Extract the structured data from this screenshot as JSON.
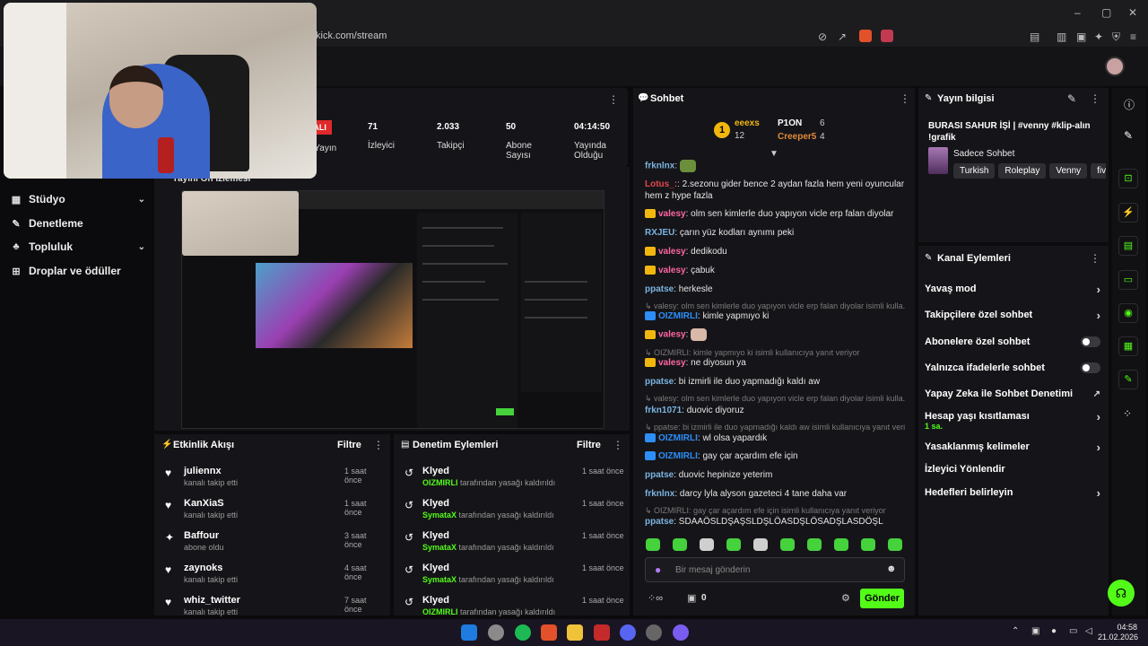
{
  "browser": {
    "url": "kick.com/stream",
    "window_controls": [
      "minimize",
      "maximize",
      "close"
    ]
  },
  "nav": {
    "items": [
      {
        "label": "Stüdyo",
        "icon": "studio-icon",
        "expandable": true
      },
      {
        "label": "Denetleme",
        "icon": "wrench-icon",
        "expandable": false
      },
      {
        "label": "Topluluk",
        "icon": "community-icon",
        "expandable": true
      },
      {
        "label": "Droplar ve ödüller",
        "icon": "drops-icon",
        "expandable": false
      }
    ]
  },
  "stats": {
    "live_label": "PALI",
    "live_caption": "lu Yayın",
    "viewers": {
      "value": "71",
      "label": "İzleyici"
    },
    "followers": {
      "value": "2.033",
      "label": "Takipçi"
    },
    "subs": {
      "value": "50",
      "label": "Abone Sayısı"
    },
    "uptime": {
      "value": "04:14:50",
      "label": "Yayında Olduğu"
    }
  },
  "preview": {
    "title": "Yayını Ön İzlemesi"
  },
  "activity": {
    "title": "Etkinlik Akışı",
    "filter": "Filtre",
    "items": [
      {
        "name": "juliennx",
        "sub": "kanalı takip etti",
        "time": "1 saat önce",
        "icon": "heart-icon"
      },
      {
        "name": "KanXiaS",
        "sub": "kanalı takip etti",
        "time": "1 saat önce",
        "icon": "heart-icon"
      },
      {
        "name": "Baffour",
        "sub": "abone oldu",
        "time": "3 saat önce",
        "icon": "star-icon"
      },
      {
        "name": "zaynoks",
        "sub": "kanalı takip etti",
        "time": "4 saat önce",
        "icon": "heart-icon"
      },
      {
        "name": "whiz_twitter",
        "sub": "kanalı takip etti",
        "time": "7 saat önce",
        "icon": "heart-icon"
      }
    ]
  },
  "modlog": {
    "title": "Denetim Eylemleri",
    "filter": "Filtre",
    "items": [
      {
        "name": "Klyed",
        "target": "OIZMIRLI",
        "action": "tarafından yasağı kaldırıldı",
        "time": "1 saat önce"
      },
      {
        "name": "Klyed",
        "target": "SymataX",
        "action": "tarafından yasağı kaldırıldı",
        "time": "1 saat önce"
      },
      {
        "name": "Klyed",
        "target": "SymataX",
        "action": "tarafından yasağı kaldırıldı",
        "time": "1 saat önce"
      },
      {
        "name": "Klyed",
        "target": "SymataX",
        "action": "tarafından yasağı kaldırıldı",
        "time": "1 saat önce"
      },
      {
        "name": "Klyed",
        "target": "OIZMIRLI",
        "action": "tarafından yasağı kaldırıldı",
        "time": "1 saat önce"
      }
    ]
  },
  "chat": {
    "title": "Sohbet",
    "leaderboard": {
      "rank": "1",
      "first": {
        "name": "eeexs",
        "count": "12"
      },
      "second": {
        "name": "P1ON",
        "count": "6"
      },
      "third": {
        "name": "Creeper5",
        "count": "4"
      }
    },
    "messages": [
      {
        "user": "frknlnx",
        "color": "#7bb3e0",
        "text": "",
        "emote": true
      },
      {
        "user": "Lotus_:",
        "color": "#e2474b",
        "text": "2.sezonu gider bence 2 aydan fazla hem yeni oyuncular hem z hype fazla"
      },
      {
        "user": "valesy",
        "color": "#ff66a3",
        "text": "olm sen kimlerle duo yapıyon vicle erp falan diyolar"
      },
      {
        "user": "RXJEU",
        "color": "#7bb3e0",
        "text": "çarın yüz kodları aynımı peki"
      },
      {
        "user": "valesy",
        "color": "#ff66a3",
        "text": "dedikodu"
      },
      {
        "user": "valesy",
        "color": "#ff66a3",
        "text": "çabuk"
      },
      {
        "user": "ppatse",
        "color": "#7bb3e0",
        "text": "herkesle"
      },
      {
        "reply": "valesy: olm sen kimlerle duo yapıyon vicle erp falan diyolar isimli kulla..."
      },
      {
        "user": "OIZMIRLI",
        "color": "#2d8ef7",
        "text": "kimle yapmıyo ki"
      },
      {
        "user": "valesy",
        "color": "#ff66a3",
        "text": "",
        "emote": true
      },
      {
        "reply": "OIZMIRLI: kimle yapmıyo ki isimli kullanıcıya yanıt veriyor"
      },
      {
        "user": "valesy",
        "color": "#ff66a3",
        "text": "ne diyosun ya"
      },
      {
        "user": "ppatse",
        "color": "#7bb3e0",
        "text": "bi izmirli ile duo yapmadığı kaldı aw"
      },
      {
        "reply": "valesy: olm sen kimlerle duo yapıyon vicle erp falan diyolar isimli kulla..."
      },
      {
        "user": "frkn1071",
        "color": "#7bb3e0",
        "text": "duovic diyoruz"
      },
      {
        "reply": "ppatse: bi izmirli ile duo yapmadığı kaldı aw isimli kullanıcıya yanıt veriyor"
      },
      {
        "user": "OIZMIRLI",
        "color": "#2d8ef7",
        "text": "wl olsa yapardık"
      },
      {
        "user": "OIZMIRLI",
        "color": "#2d8ef7",
        "text": "gay çar açardım efe için"
      },
      {
        "user": "ppatse",
        "color": "#7bb3e0",
        "text": "duovic hepinize yeterim"
      },
      {
        "user": "frknlnx",
        "color": "#7bb3e0",
        "text": "darcy lyla alyson gazeteci 4 tane daha var"
      },
      {
        "reply": "OIZMIRLI: gay çar açardım efe için isimli kullanıcıya yanıt veriyor"
      },
      {
        "user": "ppatse",
        "color": "#7bb3e0",
        "text": "SDAAÖSLDŞAŞSLDŞLÖASDŞLÖSADŞLASDÖŞL"
      }
    ],
    "placeholder": "Bir mesaj gönderin",
    "points": "0",
    "send": "Gönder"
  },
  "stream_info": {
    "title": "Yayın bilgisi",
    "stream_title": "BURASI SAHUR İŞİ | #venny #klip-alın !grafik",
    "category": "Sadece Sohbet",
    "tags": [
      "Turkish",
      "Roleplay",
      "Venny",
      "fiv"
    ]
  },
  "channel_actions": {
    "title": "Kanal Eylemleri",
    "items": [
      {
        "label": "Yavaş mod",
        "type": "chevron"
      },
      {
        "label": "Takipçilere özel sohbet",
        "type": "chevron"
      },
      {
        "label": "Abonelere özel sohbet",
        "type": "toggle"
      },
      {
        "label": "Yalnızca ifadelerle sohbet",
        "type": "toggle"
      },
      {
        "label": "Yapay Zeka ile Sohbet Denetimi",
        "type": "external"
      },
      {
        "label": "Hesap yaşı kısıtlaması",
        "type": "chevron",
        "sub": "1 sa."
      },
      {
        "label": "Yasaklanmış kelimeler",
        "type": "chevron"
      },
      {
        "label": "İzleyici Yönlendir",
        "type": "none"
      },
      {
        "label": "Hedefleri belirleyin",
        "type": "chevron"
      }
    ]
  },
  "taskbar": {
    "time": "04:58",
    "date": "21.02.2026"
  },
  "colors": {
    "accent": "#53fc18",
    "live": "#e02a2a",
    "panel": "#151519"
  }
}
